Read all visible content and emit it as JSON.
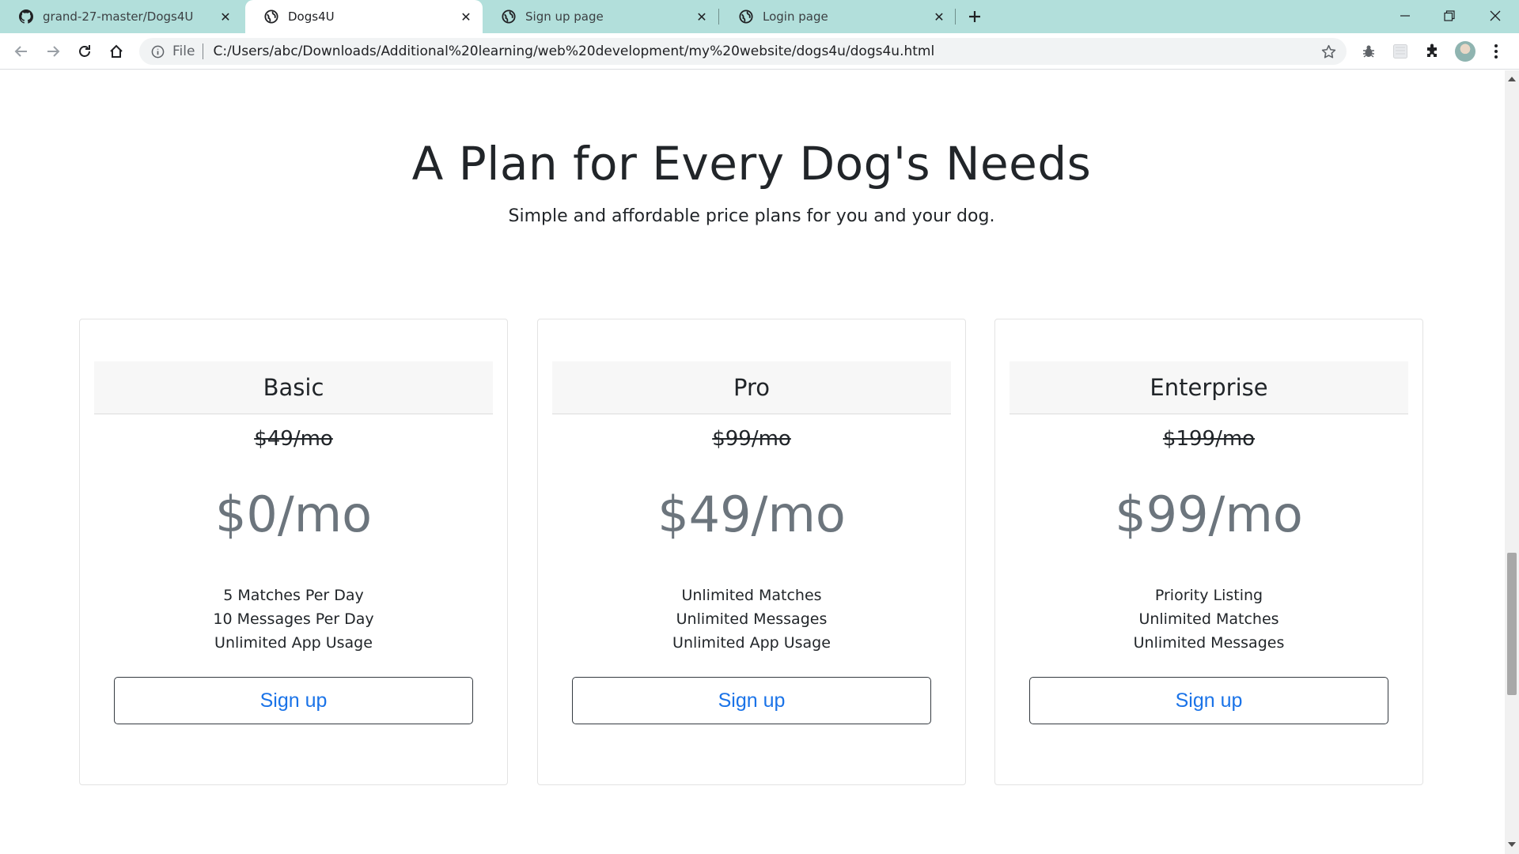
{
  "browser": {
    "tabs": [
      {
        "title": "grand-27-master/Dogs4U",
        "favicon": "github-icon",
        "active": false
      },
      {
        "title": "Dogs4U",
        "favicon": "globe-icon",
        "active": true
      },
      {
        "title": "Sign up page",
        "favicon": "globe-icon",
        "active": false
      },
      {
        "title": "Login page",
        "favicon": "globe-icon",
        "active": false
      }
    ],
    "address_bar": {
      "scheme_label": "File",
      "url": "C:/Users/abc/Downloads/Additional%20learning/web%20development/my%20website/dogs4u/dogs4u.html"
    },
    "colors": {
      "tabstrip": "#b2dfdb",
      "active_tab": "#ffffff"
    }
  },
  "page": {
    "title": "A Plan for Every Dog's Needs",
    "subtitle": "Simple and affordable price plans for you and your dog.",
    "plans": [
      {
        "name": "Basic",
        "old_price": "$49/mo",
        "price": "$0/mo",
        "features": [
          "5 Matches Per Day",
          "10 Messages Per Day",
          "Unlimited App Usage"
        ],
        "button": "Sign up"
      },
      {
        "name": "Pro",
        "old_price": "$99/mo",
        "price": "$49/mo",
        "features": [
          "Unlimited Matches",
          "Unlimited Messages",
          "Unlimited App Usage"
        ],
        "button": "Sign up"
      },
      {
        "name": "Enterprise",
        "old_price": "$199/mo",
        "price": "$99/mo",
        "features": [
          "Priority Listing",
          "Unlimited Matches",
          "Unlimited Messages"
        ],
        "button": "Sign up"
      }
    ],
    "colors": {
      "price_text": "#6c757d",
      "button_text": "#1a73e8",
      "card_header_bg": "#f7f7f7"
    }
  }
}
